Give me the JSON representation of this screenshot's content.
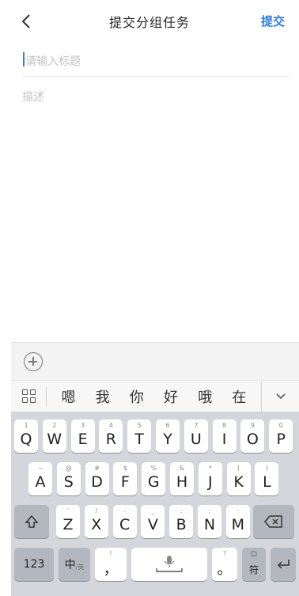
{
  "header": {
    "back_icon": "chevron-left-icon",
    "title": "提交分组任务",
    "submit_label": "提交",
    "accent_color": "#2e7ee6"
  },
  "form": {
    "title_placeholder": "请输入标题",
    "title_value": "",
    "description_placeholder": "描述",
    "description_value": ""
  },
  "toolbar": {
    "add_icon": "plus-circle-icon"
  },
  "ime": {
    "menu_icon": "grid-icon",
    "candidates": [
      "嗯",
      "我",
      "你",
      "好",
      "哦",
      "在"
    ],
    "expand_icon": "chevron-down-icon"
  },
  "keyboard": {
    "row1": [
      {
        "hint": "1",
        "label": "Q"
      },
      {
        "hint": "2",
        "label": "W"
      },
      {
        "hint": "3",
        "label": "E"
      },
      {
        "hint": "4",
        "label": "R"
      },
      {
        "hint": "5",
        "label": "T"
      },
      {
        "hint": "6",
        "label": "Y"
      },
      {
        "hint": "7",
        "label": "U"
      },
      {
        "hint": "8",
        "label": "I"
      },
      {
        "hint": "9",
        "label": "O"
      },
      {
        "hint": "0",
        "label": "P"
      }
    ],
    "row2": [
      {
        "hint": "~",
        "label": "A"
      },
      {
        "hint": "@",
        "label": "S"
      },
      {
        "hint": "#",
        "label": "D"
      },
      {
        "hint": "$",
        "label": "F"
      },
      {
        "hint": "%",
        "label": "G"
      },
      {
        "hint": "&",
        "label": "H"
      },
      {
        "hint": "*",
        "label": "J"
      },
      {
        "hint": "(",
        "label": "K"
      },
      {
        "hint": ")",
        "label": "L"
      }
    ],
    "row3": [
      {
        "hint": "'",
        "label": "Z"
      },
      {
        "hint": "/",
        "label": "X"
      },
      {
        "hint": "-",
        "label": "C"
      },
      {
        "hint": "_",
        "label": "V"
      },
      {
        "hint": ":",
        "label": "B"
      },
      {
        "hint": ";",
        "label": "N"
      },
      {
        "hint": "·",
        "label": "M"
      }
    ],
    "shift_icon": "shift-icon",
    "backspace_icon": "backspace-icon",
    "num_label": "123",
    "lang_label": "中",
    "lang_sub": "/英",
    "comma_hint": "!",
    "comma_label": "，",
    "space_icon": "microphone-icon",
    "period_hint": "?",
    "period_label": "。",
    "symbol_label": "符",
    "enter_icon": "return-icon"
  }
}
